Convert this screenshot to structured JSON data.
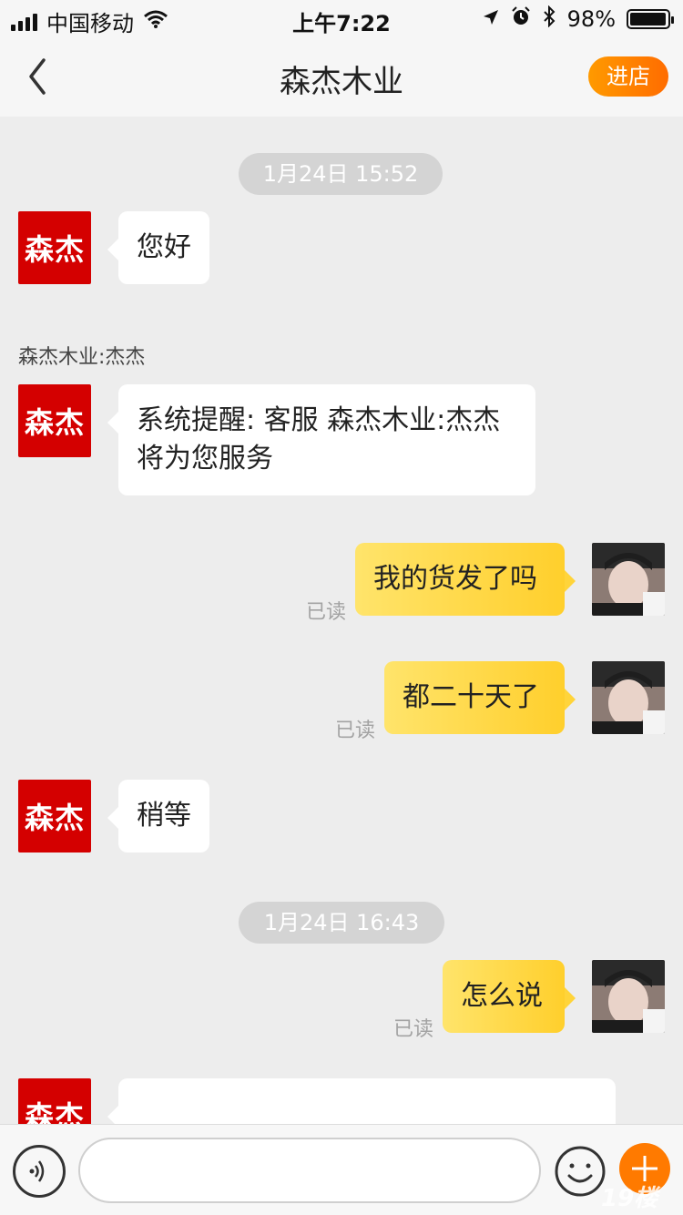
{
  "status_bar": {
    "carrier": "中国移动",
    "time": "上午7:22",
    "battery_percent": "98%",
    "battery_level": 0.98,
    "icons": [
      "signal-icon",
      "wifi-icon",
      "location-icon",
      "alarm-icon",
      "bluetooth-icon",
      "battery-icon"
    ]
  },
  "nav": {
    "title": "森杰木业",
    "shop_button": "进店",
    "back_icon": "chevron-left-icon"
  },
  "messages": {
    "time1": "1月24日 15:52",
    "m1": {
      "from": "shop",
      "avatar_text": "森杰",
      "text": "您好"
    },
    "sender_label": "森杰木业:杰杰",
    "m2": {
      "from": "shop",
      "avatar_text": "森杰",
      "text": "系统提醒: 客服 森杰木业:杰杰将为您服务"
    },
    "m3": {
      "from": "user",
      "text": "我的货发了吗",
      "status": "已读"
    },
    "m4": {
      "from": "user",
      "text": "都二十天了",
      "status": "已读"
    },
    "m5": {
      "from": "shop",
      "avatar_text": "森杰",
      "text": "稍等"
    },
    "time2": "1月24日 16:43",
    "m6": {
      "from": "user",
      "text": "怎么说",
      "status": "已读"
    },
    "m7": {
      "from": "shop",
      "avatar_text": "森杰",
      "text": ""
    }
  },
  "input_bar": {
    "input_value": "",
    "voice_icon": "voice-icon",
    "emoji_icon": "emoji-icon",
    "plus_icon": "plus-icon",
    "watermark": "19楼"
  },
  "colors": {
    "shop_red": "#d40000",
    "accent_orange": "#ff7a00",
    "bubble_yellow": "#ffd43a"
  }
}
